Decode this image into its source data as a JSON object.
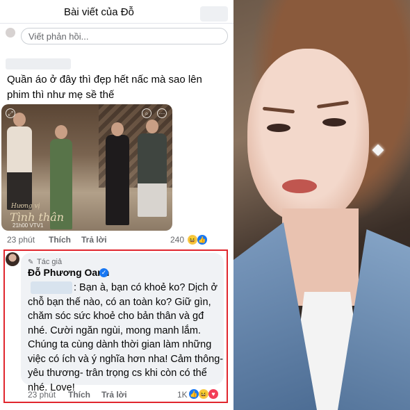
{
  "header": {
    "title": "Bài viết của Đỗ"
  },
  "reply": {
    "placeholder": "Viết phản hồi..."
  },
  "comment1": {
    "text": "Quần áo ở đây thì đẹp hết nấc mà sao lên phim thì như mẹ sề thế",
    "image_watermark": {
      "line1": "Hương vị",
      "line2": "Tình thân",
      "line3": "21h00 VTV1"
    },
    "time": "23 phút",
    "like_label": "Thích",
    "reply_label": "Trả lời",
    "reaction_count": "240",
    "reaction_icons": [
      "haha-icon",
      "like-icon"
    ]
  },
  "author_comment": {
    "author_badge": "Tác giả",
    "author_name": "Đỗ Phương Oanh",
    "text": ": Bạn à, bạn có khoẻ ko? Dịch ở chỗ bạn thế nào, có an toàn ko? Giữ gìn, chăm sóc sức khoẻ cho bản thân và gđ nhé. Cười ngăn ngùi, mong manh lắm. Chúng ta cùng dành thời gian làm những việc có ích và ý nghĩa hơn nha! Cảm thông- yêu thương- trân trọng cs khi còn có thể nhé. Love!",
    "time": "23 phút",
    "like_label": "Thích",
    "reply_label": "Trả lời",
    "reaction_count": "1K",
    "reaction_icons": [
      "like-icon",
      "haha-icon",
      "love-icon"
    ]
  },
  "colors": {
    "highlight_frame": "#e0262d",
    "verified": "#1877f2",
    "bubble": "#f0f2f5"
  }
}
